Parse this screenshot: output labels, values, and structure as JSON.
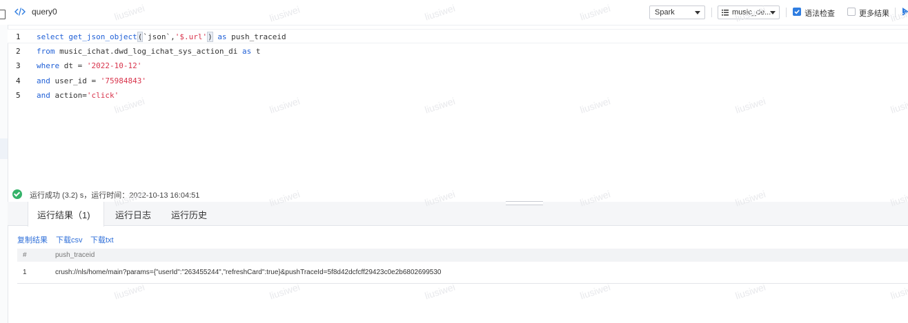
{
  "header": {
    "tab_title": "query0",
    "engine_select": "Spark",
    "database_select": "music_de...",
    "syntax_check_label": "语法检查",
    "syntax_check_checked": true,
    "more_results_label": "更多结果",
    "more_results_checked": false
  },
  "editor": {
    "lines": [
      {
        "num": "1",
        "tokens": [
          {
            "t": "select ",
            "c": "kw"
          },
          {
            "t": "get_json_object",
            "c": "fn"
          },
          {
            "t": "(",
            "c": "br"
          },
          {
            "t": "`json`",
            "c": ""
          },
          {
            "t": ",",
            "c": ""
          },
          {
            "t": "'$.url'",
            "c": "str"
          },
          {
            "t": ")",
            "c": "br"
          },
          {
            "t": " ",
            "c": ""
          },
          {
            "t": "as",
            "c": "kw"
          },
          {
            "t": " push_traceid",
            "c": ""
          }
        ]
      },
      {
        "num": "2",
        "tokens": [
          {
            "t": "from",
            "c": "kw"
          },
          {
            "t": " music_ichat.dwd_log_ichat_sys_action_di ",
            "c": ""
          },
          {
            "t": "as",
            "c": "kw"
          },
          {
            "t": " t",
            "c": ""
          }
        ]
      },
      {
        "num": "3",
        "tokens": [
          {
            "t": "where",
            "c": "kw"
          },
          {
            "t": " dt = ",
            "c": ""
          },
          {
            "t": "'2022-10-12'",
            "c": "str"
          }
        ]
      },
      {
        "num": "4",
        "tokens": [
          {
            "t": "and",
            "c": "kw"
          },
          {
            "t": " user_id = ",
            "c": ""
          },
          {
            "t": "'75984843'",
            "c": "str"
          }
        ]
      },
      {
        "num": "5",
        "tokens": [
          {
            "t": "and",
            "c": "kw"
          },
          {
            "t": " action=",
            "c": ""
          },
          {
            "t": "'click'",
            "c": "str"
          }
        ]
      }
    ]
  },
  "status": {
    "text": "运行成功 (3.2) s，运行时间：2022-10-13 16:04:51"
  },
  "result_tabs": [
    {
      "label": "运行结果（1)"
    },
    {
      "label": "运行日志"
    },
    {
      "label": "运行历史"
    }
  ],
  "actions": {
    "copy": "复制结果",
    "csv": "下载csv",
    "txt": "下载txt"
  },
  "table": {
    "headers": [
      "#",
      "push_traceid"
    ],
    "rows": [
      [
        "1",
        "crush://nls/home/main?params={\"userId\":\"263455244\",\"refreshCard\":true}&pushTraceId=5f8d42dcfcff29423c0e2b6802699530"
      ]
    ]
  },
  "watermark": "liusiwei",
  "colors": {
    "accent": "#2f7de1",
    "success": "#35b36a",
    "keyword": "#1f5fd6",
    "string": "#d8344c"
  }
}
